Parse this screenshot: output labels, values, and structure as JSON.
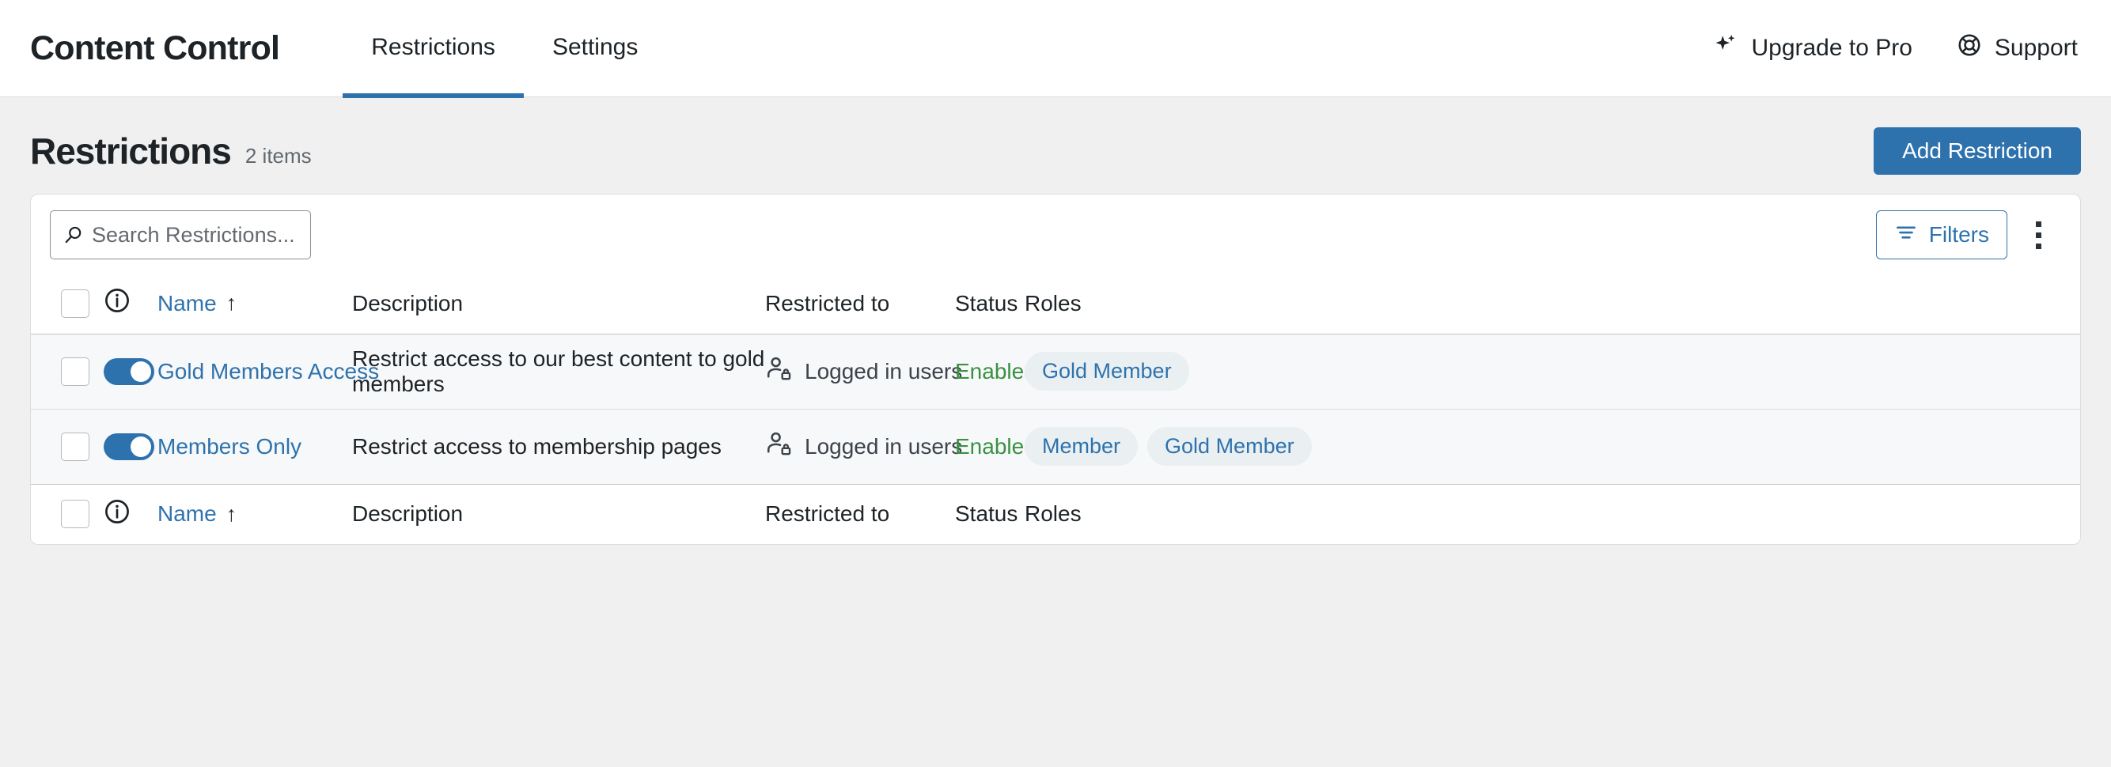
{
  "appbar": {
    "brand": "Content Control",
    "tabs": [
      {
        "label": "Restrictions",
        "active": true
      },
      {
        "label": "Settings",
        "active": false
      }
    ],
    "actions": [
      {
        "label": "Upgrade to Pro",
        "icon": "sparkle-icon"
      },
      {
        "label": "Support",
        "icon": "lifebuoy-icon"
      }
    ]
  },
  "page": {
    "title": "Restrictions",
    "count": "2 items",
    "add_button": "Add Restriction"
  },
  "toolbar": {
    "search_placeholder": "Search Restrictions...",
    "search_value": "",
    "filters_label": "Filters",
    "more_label": "More actions"
  },
  "table": {
    "columns": {
      "name": "Name",
      "description": "Description",
      "restricted_to": "Restricted to",
      "status": "Status",
      "roles": "Roles"
    },
    "sort_indicator": "↑",
    "rows": [
      {
        "enabled": true,
        "name": "Gold Members Access",
        "description": "Restrict access to our best content to gold members",
        "restricted_to": "Logged in users",
        "status": "Enabled",
        "roles": [
          "Gold Member"
        ]
      },
      {
        "enabled": true,
        "name": "Members Only",
        "description": "Restrict access to membership pages",
        "restricted_to": "Logged in users",
        "status": "Enabled",
        "roles": [
          "Member",
          "Gold Member"
        ]
      }
    ]
  },
  "colors": {
    "accent": "#2e72ad",
    "status_enabled": "#3a9142",
    "pill_bg": "#eaeff2",
    "page_bg": "#f0f0f1",
    "row_bg": "#f7f8f9"
  }
}
